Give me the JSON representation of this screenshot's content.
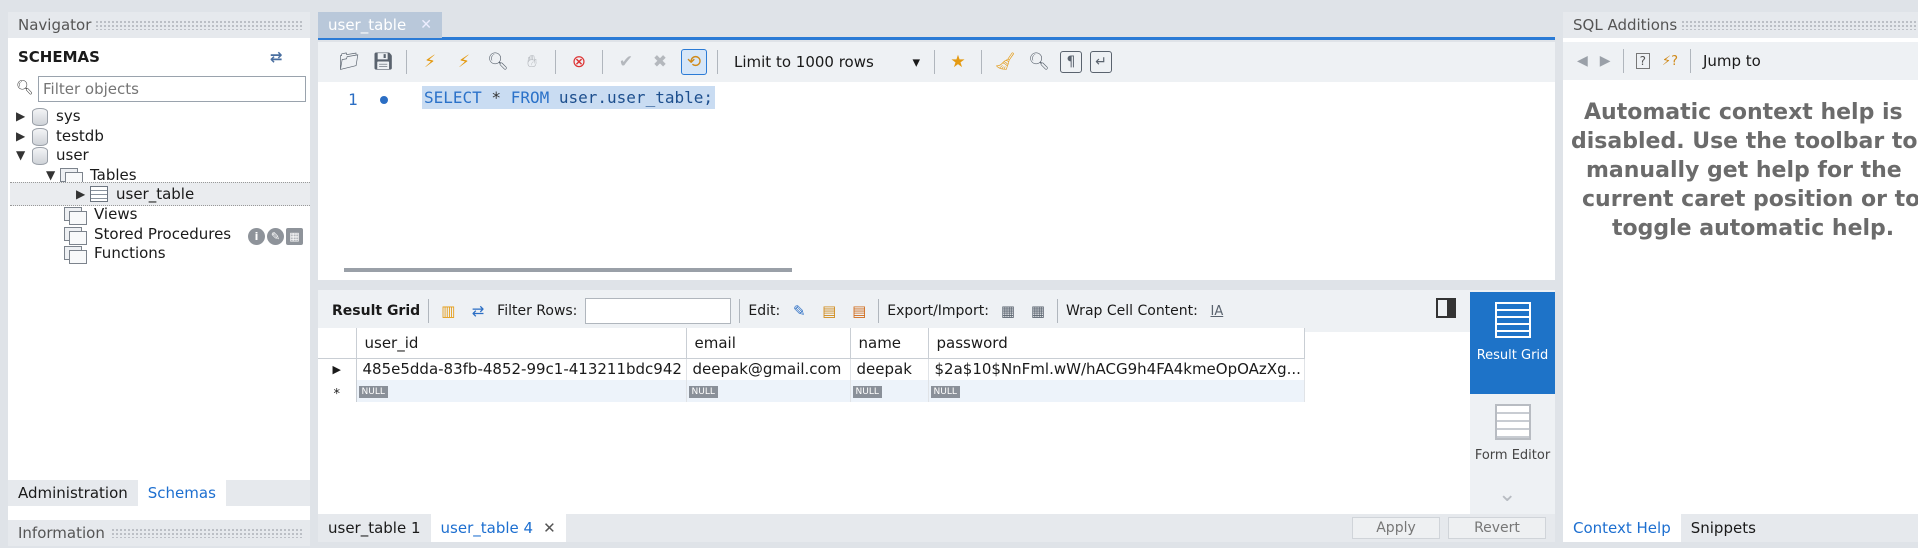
{
  "navigator": {
    "title": "Navigator",
    "schemas_label": "SCHEMAS",
    "filter_placeholder": "Filter objects",
    "tree": {
      "sys": "sys",
      "testdb": "testdb",
      "user": "user",
      "tables": "Tables",
      "user_table": "user_table",
      "views": "Views",
      "stored_procedures": "Stored Procedures",
      "functions": "Functions"
    },
    "tabs": [
      "Administration",
      "Schemas"
    ],
    "information": "Information"
  },
  "editor": {
    "tab_label": "user_table",
    "limit_label": "Limit to 1000 rows",
    "line_number": "1",
    "sql": {
      "kw_select": "SELECT",
      "star": " * ",
      "kw_from": "FROM",
      "table": " user.user_table;"
    }
  },
  "results": {
    "toolbar": {
      "result_grid": "Result Grid",
      "filter_rows": "Filter Rows:",
      "edit": "Edit:",
      "export_import": "Export/Import:",
      "wrap_cell": "Wrap Cell Content:"
    },
    "columns": [
      "user_id",
      "email",
      "name",
      "password"
    ],
    "rows": [
      [
        "485e5dda-83fb-4852-99c1-413211bdc942",
        "deepak@gmail.com",
        "deepak",
        "$2a$10$NnFml.wW/hACG9h4FA4kmeOpOAzXg..."
      ]
    ],
    "null_label": "NULL",
    "side_buttons": {
      "result_grid": "Result Grid",
      "form_editor": "Form Editor"
    },
    "bottom_tabs": [
      "user_table 1",
      "user_table 4"
    ],
    "apply": "Apply",
    "revert": "Revert"
  },
  "sql_additions": {
    "title": "SQL Additions",
    "jump_to": "Jump to",
    "help_lines": [
      "Automatic context help is",
      "disabled. Use the toolbar to",
      "manually get help for the",
      "current caret position or to",
      "toggle automatic help."
    ],
    "tabs": [
      "Context Help",
      "Snippets"
    ]
  },
  "colors": {
    "accent": "#1e73c8",
    "link_tab": "#1d6fd0",
    "sql_keyword": "#2b72c9"
  }
}
